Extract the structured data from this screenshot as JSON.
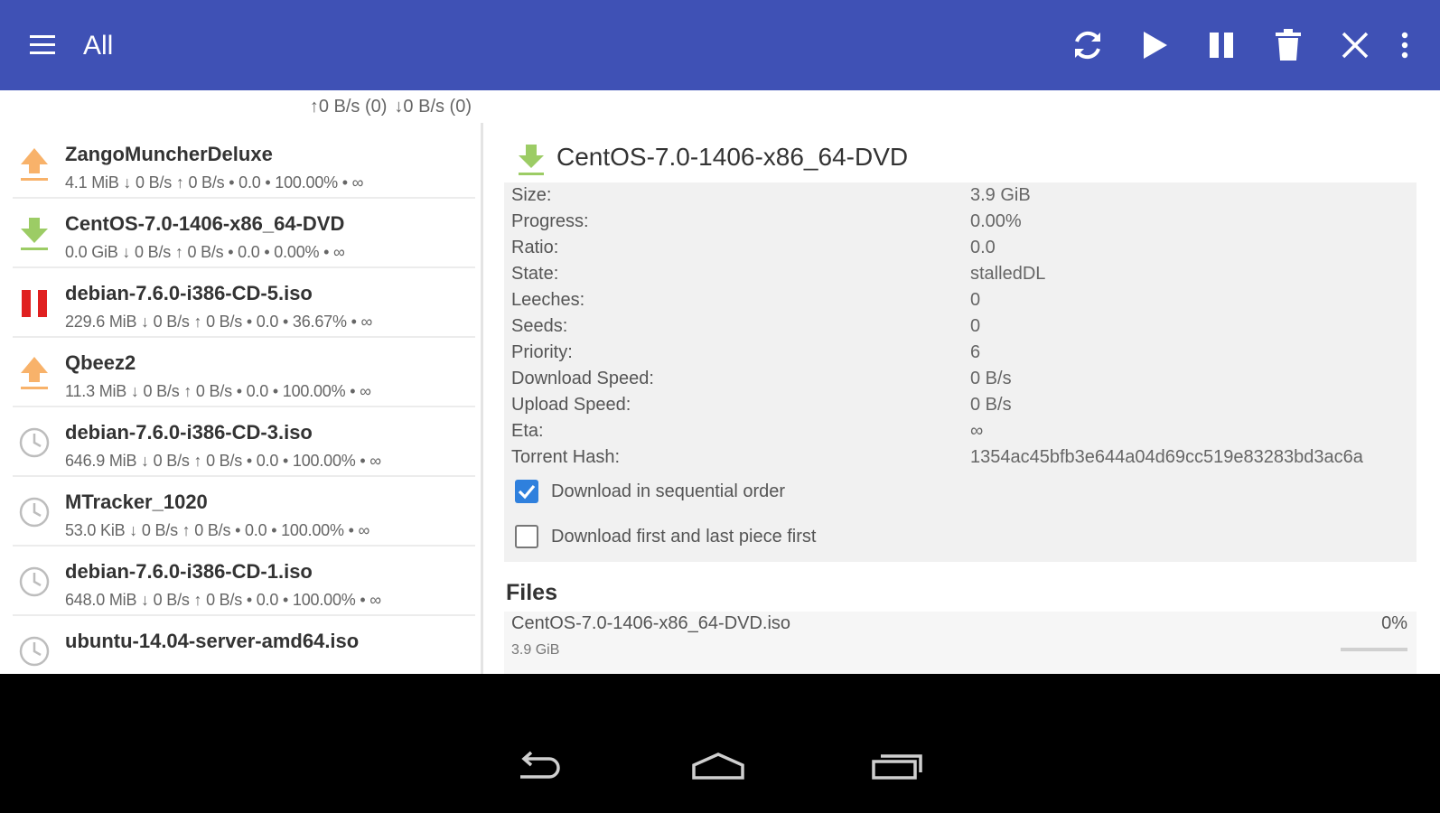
{
  "appbar": {
    "title": "All",
    "actions": [
      "refresh-icon",
      "play-icon",
      "pause-icon",
      "trash-icon",
      "close-icon",
      "more-vert-icon"
    ]
  },
  "speed_bar": {
    "upload": "0 B/s (0)",
    "download": "0 B/s (0)"
  },
  "torrents": [
    {
      "name": "ZangoMuncherDeluxe",
      "info": "4.1 MiB ↓ 0 B/s ↑ 0 B/s • 0.0 • 100.00% • ∞",
      "icon": "upload-arrow-icon",
      "color": "#f8b26a"
    },
    {
      "name": "CentOS-7.0-1406-x86_64-DVD",
      "info": "0.0 GiB ↓ 0 B/s ↑ 0 B/s • 0.0 • 0.00% • ∞",
      "icon": "download-arrow-icon",
      "color": "#9ccc65"
    },
    {
      "name": "debian-7.6.0-i386-CD-5.iso",
      "info": "229.6 MiB ↓ 0 B/s ↑ 0 B/s • 0.0 • 36.67% • ∞",
      "icon": "paused-icon",
      "color": "#e02020"
    },
    {
      "name": "Qbeez2",
      "info": "11.3 MiB ↓ 0 B/s ↑ 0 B/s • 0.0 • 100.00% • ∞",
      "icon": "upload-arrow-icon",
      "color": "#f8b26a"
    },
    {
      "name": "debian-7.6.0-i386-CD-3.iso",
      "info": "646.9 MiB ↓ 0 B/s ↑ 0 B/s • 0.0 • 100.00% • ∞",
      "icon": "clock-icon",
      "color": "#bdbdbd"
    },
    {
      "name": "MTracker_1020",
      "info": "53.0 KiB ↓ 0 B/s ↑ 0 B/s • 0.0 • 100.00% • ∞",
      "icon": "clock-icon",
      "color": "#bdbdbd"
    },
    {
      "name": "debian-7.6.0-i386-CD-1.iso",
      "info": "648.0 MiB ↓ 0 B/s ↑ 0 B/s • 0.0 • 100.00% • ∞",
      "icon": "clock-icon",
      "color": "#bdbdbd"
    },
    {
      "name": "ubuntu-14.04-server-amd64.iso",
      "info": "",
      "icon": "clock-icon",
      "color": "#bdbdbd"
    }
  ],
  "detail": {
    "title": "CentOS-7.0-1406-x86_64-DVD",
    "properties": [
      {
        "key": "Size:",
        "value": "3.9 GiB"
      },
      {
        "key": "Progress:",
        "value": "0.00%"
      },
      {
        "key": "Ratio:",
        "value": "0.0"
      },
      {
        "key": "State:",
        "value": "stalledDL"
      },
      {
        "key": "Leeches:",
        "value": "0"
      },
      {
        "key": "Seeds:",
        "value": "0"
      },
      {
        "key": "Priority:",
        "value": "6"
      },
      {
        "key": "Download Speed:",
        "value": "0 B/s"
      },
      {
        "key": "Upload Speed:",
        "value": "0 B/s"
      },
      {
        "key": "Eta:",
        "value": "∞"
      },
      {
        "key": "Torrent Hash:",
        "value": "1354ac45bfb3e644a04d69cc519e83283bd3ac6a"
      }
    ],
    "options": [
      {
        "label": "Download in sequential order",
        "checked": true
      },
      {
        "label": "Download first and last piece first",
        "checked": false
      }
    ],
    "files_heading": "Files",
    "files": [
      {
        "name": "CentOS-7.0-1406-x86_64-DVD.iso",
        "size": "3.9 GiB",
        "percent": "0%",
        "progress": 0
      }
    ]
  },
  "navbar": {
    "buttons": [
      "back-icon",
      "home-icon",
      "recents-icon"
    ]
  },
  "colors": {
    "appbar": "#3f51b5",
    "checkbox_checked": "#2f80dd",
    "seeding": "#f8b26a",
    "downloading": "#9ccc65",
    "paused": "#e02020",
    "queued": "#bdbdbd"
  }
}
